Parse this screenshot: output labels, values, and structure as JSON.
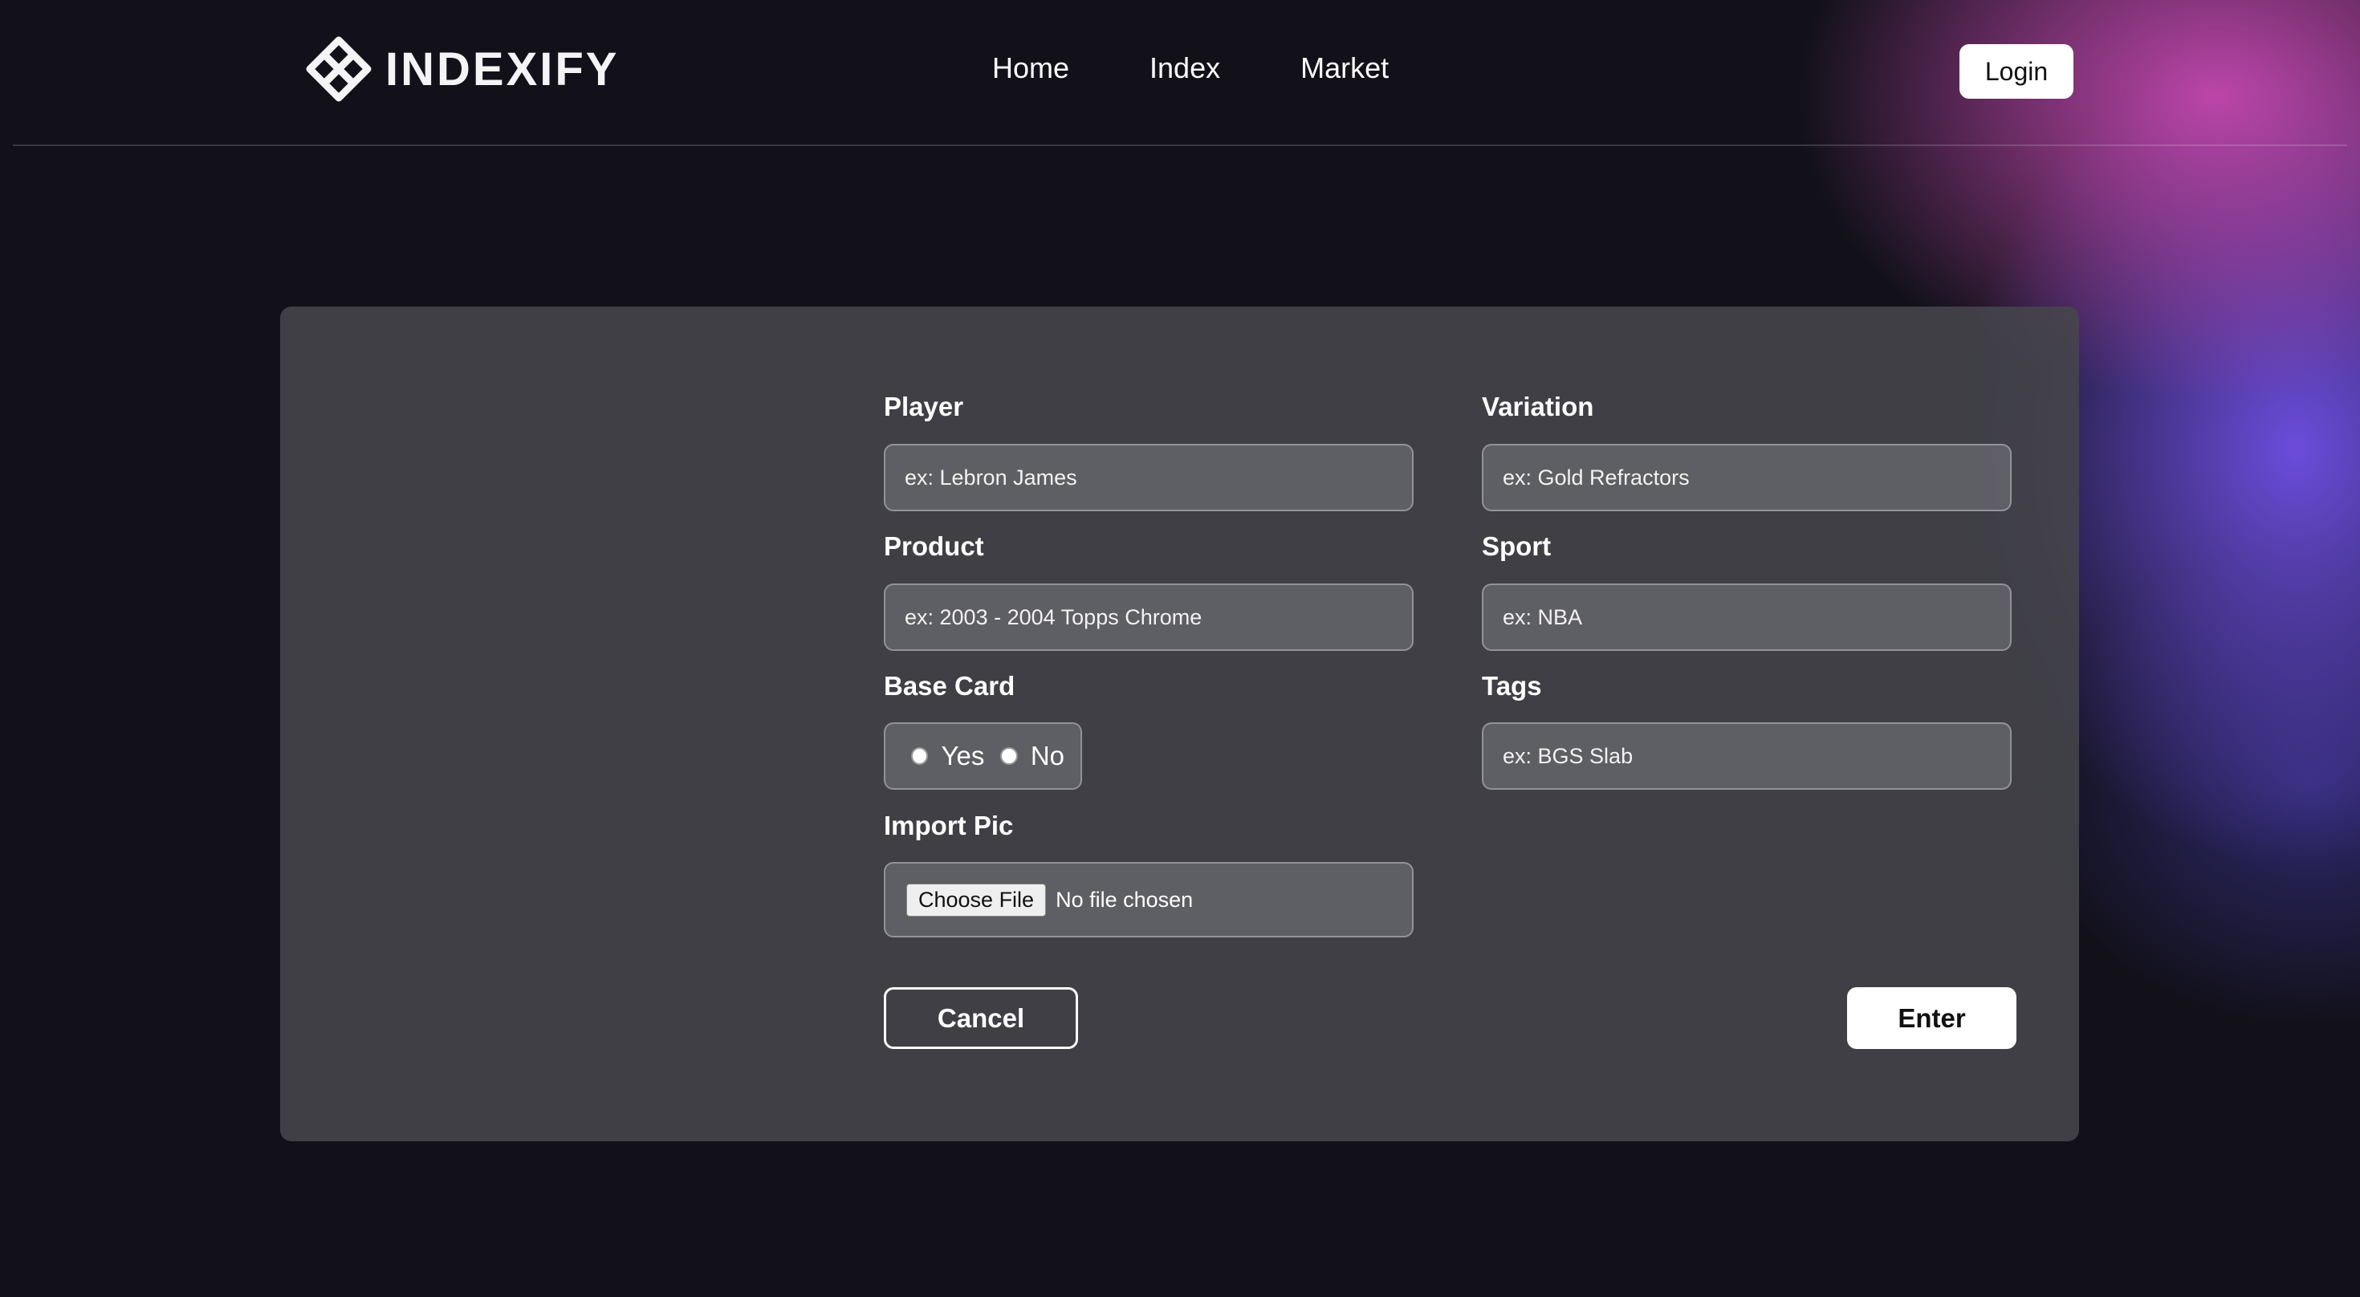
{
  "brand": {
    "name": "INDEXIFY",
    "logo_icon": "interlocked-diamond-logo-icon"
  },
  "nav": {
    "items": [
      {
        "label": "Home"
      },
      {
        "label": "Index"
      },
      {
        "label": "Market"
      }
    ],
    "login_label": "Login"
  },
  "form": {
    "player": {
      "label": "Player",
      "placeholder": "ex: Lebron James",
      "value": ""
    },
    "variation": {
      "label": "Variation",
      "placeholder": "ex: Gold Refractors",
      "value": ""
    },
    "product": {
      "label": "Product",
      "placeholder": "ex: 2003 - 2004 Topps Chrome",
      "value": ""
    },
    "sport": {
      "label": "Sport",
      "placeholder": "ex: NBA",
      "value": ""
    },
    "base_card": {
      "label": "Base Card",
      "options": [
        {
          "label": "Yes",
          "selected": false
        },
        {
          "label": "No",
          "selected": false
        }
      ]
    },
    "tags": {
      "label": "Tags",
      "placeholder": "ex: BGS Slab",
      "value": ""
    },
    "import_pic": {
      "label": "Import Pic",
      "button_label": "Choose File",
      "status": "No file chosen"
    },
    "cancel_label": "Cancel",
    "enter_label": "Enter"
  },
  "colors": {
    "background": "#12111a",
    "card": "#46454b",
    "glow_pink": "#c448b0",
    "glow_purple": "#7050e6"
  }
}
